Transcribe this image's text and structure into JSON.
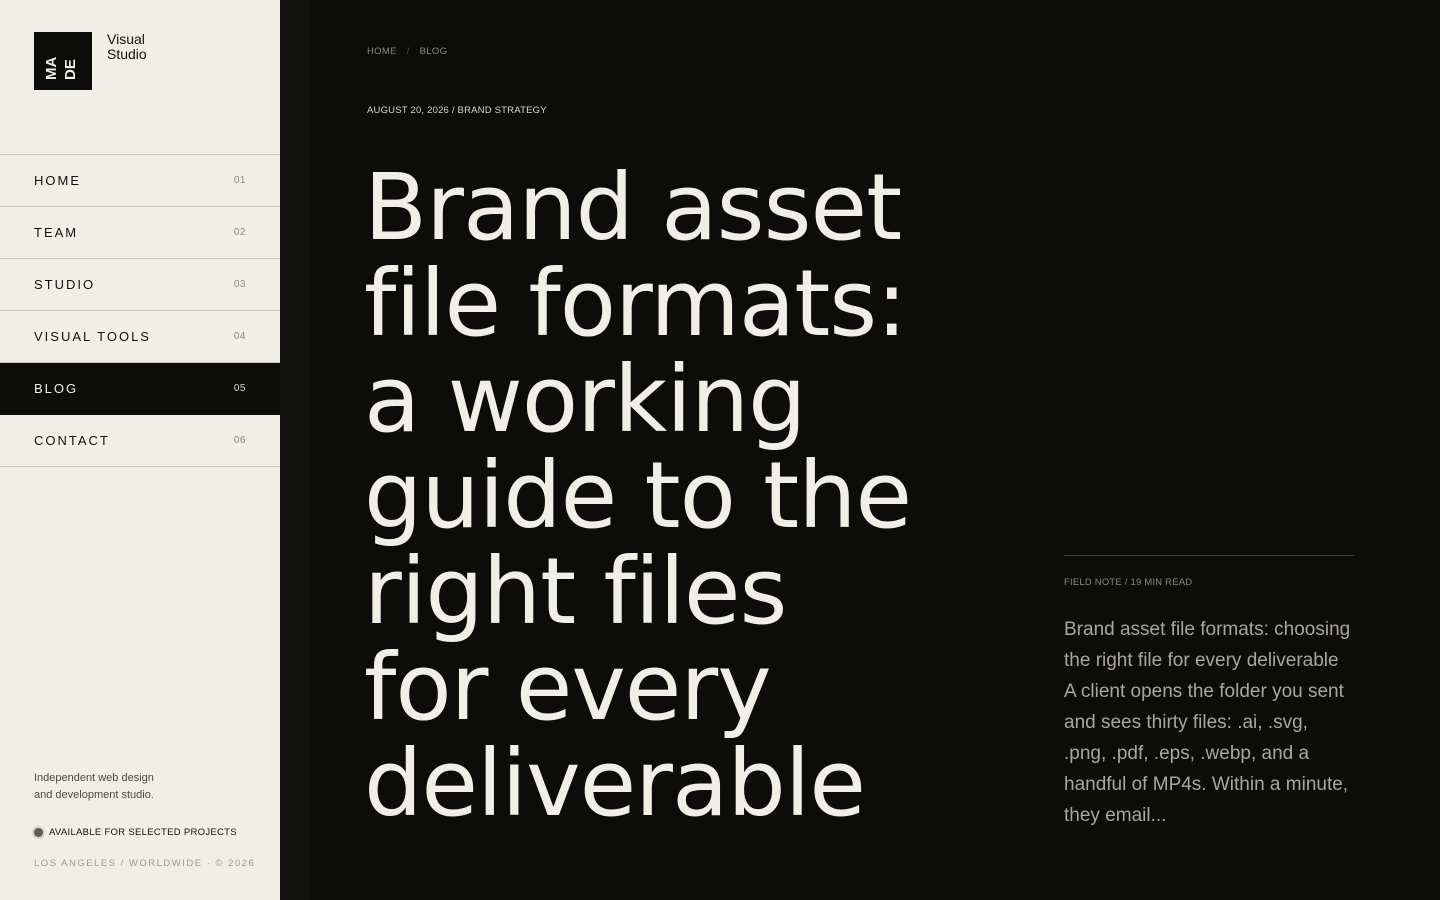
{
  "brand": {
    "logo_line1": "MA",
    "logo_line2": "DE",
    "name_line1": "Visual",
    "name_line2": "Studio"
  },
  "nav": {
    "items": [
      {
        "label": "HOME",
        "num": "01"
      },
      {
        "label": "TEAM",
        "num": "02"
      },
      {
        "label": "STUDIO",
        "num": "03"
      },
      {
        "label": "VISUAL TOOLS",
        "num": "04"
      },
      {
        "label": "BLOG",
        "num": "05",
        "active": true
      },
      {
        "label": "CONTACT",
        "num": "06"
      }
    ]
  },
  "sidebar_footer": {
    "tagline_line1": "Independent web design",
    "tagline_line2": "and development studio.",
    "availability": "AVAILABLE FOR SELECTED PROJECTS",
    "location": "LOS ANGELES / WORLDWIDE · © 2026"
  },
  "breadcrumb": {
    "home": "HOME",
    "separator": "/",
    "current": "BLOG"
  },
  "article": {
    "meta": "AUGUST 20, 2026 / BRAND STRATEGY",
    "headline_lines": [
      "Brand asset",
      "file formats:",
      "a working",
      "guide to the",
      "right files",
      "for every",
      "deliverable"
    ],
    "kicker": "FIELD NOTE / 19 MIN READ",
    "excerpt": "Brand asset file formats: choosing the right file for every deliverable A client opens the folder you sent and sees thirty files: .ai, .svg, .png, .pdf, .eps, .webp, and a handful of MP4s. Within a minute, they email..."
  },
  "colors": {
    "background_dark": "#0c0c0a",
    "background_light": "#f1eee8",
    "text_light": "#f1eee8",
    "text_muted": "#a9a6a0"
  }
}
